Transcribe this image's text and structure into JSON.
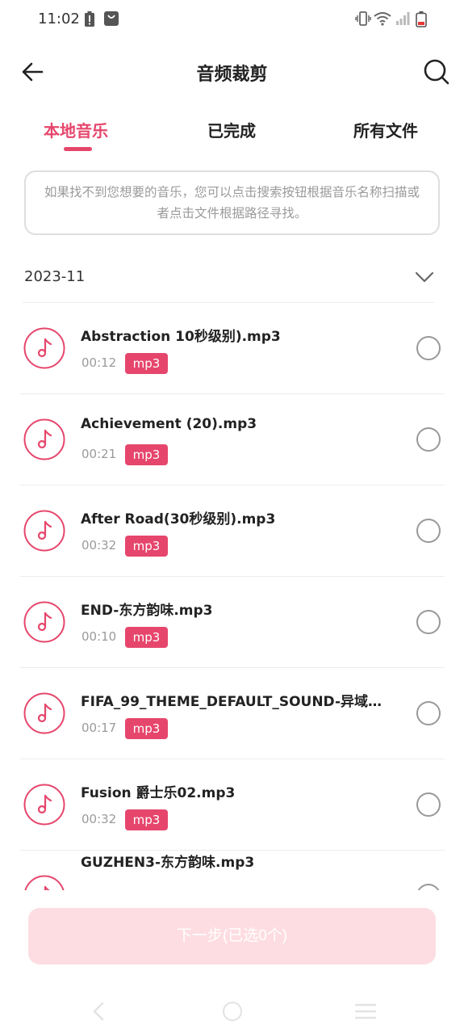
{
  "status_bar": {
    "time": "11:02"
  },
  "header": {
    "title": "音频裁剪"
  },
  "tabs": [
    {
      "label": "本地音乐",
      "active": true
    },
    {
      "label": "已完成",
      "active": false
    },
    {
      "label": "所有文件",
      "active": false
    }
  ],
  "hint": "如果找不到您想要的音乐，您可以点击搜索按钮根据音乐名称扫描或者点击文件根据路径寻找。",
  "group": {
    "date": "2023-11"
  },
  "items": [
    {
      "name": "Abstraction 10秒级别).mp3",
      "duration": "00:12",
      "format": "mp3"
    },
    {
      "name": "Achievement (20).mp3",
      "duration": "00:21",
      "format": "mp3"
    },
    {
      "name": "After Road(30秒级别).mp3",
      "duration": "00:32",
      "format": "mp3"
    },
    {
      "name": "END-东方韵味.mp3",
      "duration": "00:10",
      "format": "mp3"
    },
    {
      "name": "FIFA_99_THEME_DEFAULT_SOUND-异域风...",
      "duration": "00:17",
      "format": "mp3"
    },
    {
      "name": "Fusion 爵士乐02.mp3",
      "duration": "00:32",
      "format": "mp3"
    },
    {
      "name": "GUZHEN3-东方韵味.mp3",
      "duration": "",
      "format": ""
    }
  ],
  "next_button": {
    "label": "下一步(已选0个)"
  },
  "colors": {
    "accent": "#e6466c",
    "button_disabled": "#fddde2"
  },
  "icons": {
    "back": "arrow-left-icon",
    "search": "search-icon",
    "chevron": "chevron-down-icon",
    "note": "music-note-icon"
  }
}
